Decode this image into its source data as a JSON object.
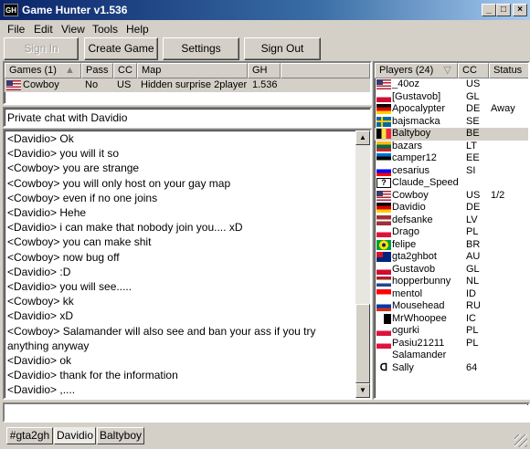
{
  "window": {
    "title": "Game Hunter v1.536",
    "app_icon_text": "GH"
  },
  "menu": [
    "File",
    "Edit",
    "View",
    "Tools",
    "Help"
  ],
  "toolbar": {
    "sign_in": "Sign In",
    "create_game": "Create Game",
    "settings": "Settings",
    "sign_out": "Sign Out"
  },
  "games": {
    "headers": {
      "games": "Games (1)",
      "pass": "Pass",
      "cc": "CC",
      "map": "Map",
      "gh": "GH"
    },
    "rows": [
      {
        "flag": "US",
        "name": "Cowboy",
        "pass": "No",
        "cc": "US",
        "map": "Hidden surprise 2player",
        "gh": "1.536"
      }
    ]
  },
  "chat": {
    "title": "Private chat with Davidio",
    "lines": [
      "<Davidio> Ok",
      "<Davidio> you will it so",
      "<Cowboy> you are strange",
      "<Cowboy> you will only host on your gay map",
      "<Cowboy> even if no one joins",
      "<Davidio> Hehe",
      "<Davidio> i can make that nobody join you.... xD",
      "<Cowboy> you can make shit",
      "<Cowboy> now bug off",
      "<Davidio> :D",
      "<Davidio> you will see.....",
      "<Cowboy> kk",
      "<Davidio> xD",
      "<Cowboy> Salamander will also see and ban your ass if you try anything anyway",
      "<Davidio> ok",
      "<Davidio> thank for the information",
      "<Davidio> ,...."
    ],
    "input_value": ""
  },
  "players": {
    "headers": {
      "players": "Players (24)",
      "cc": "CC",
      "status": "Status"
    },
    "rows": [
      {
        "flag": "US",
        "name": "_40oz",
        "cc": "US",
        "status": ""
      },
      {
        "flag": "GL",
        "name": "[Gustavob]",
        "cc": "GL",
        "status": ""
      },
      {
        "flag": "DE",
        "name": "Apocalypter",
        "cc": "DE",
        "status": "Away"
      },
      {
        "flag": "SE",
        "name": "bajsmacka",
        "cc": "SE",
        "status": ""
      },
      {
        "flag": "BE",
        "name": "Baltyboy",
        "cc": "BE",
        "status": ""
      },
      {
        "flag": "LT",
        "name": "bazars",
        "cc": "LT",
        "status": ""
      },
      {
        "flag": "EE",
        "name": "camper12",
        "cc": "EE",
        "status": ""
      },
      {
        "flag": "SI",
        "name": "cesarius",
        "cc": "SI",
        "status": ""
      },
      {
        "flag": "?",
        "name": "Claude_Speed",
        "cc": "",
        "status": ""
      },
      {
        "flag": "US",
        "name": "Cowboy",
        "cc": "US",
        "status": "1/2"
      },
      {
        "flag": "DE",
        "name": "Davidio",
        "cc": "DE",
        "status": ""
      },
      {
        "flag": "LV",
        "name": "defsanke",
        "cc": "LV",
        "status": ""
      },
      {
        "flag": "PL",
        "name": "Drago",
        "cc": "PL",
        "status": ""
      },
      {
        "flag": "BR",
        "name": "felipe",
        "cc": "BR",
        "status": ""
      },
      {
        "flag": "AU",
        "name": "gta2ghbot",
        "cc": "AU",
        "status": ""
      },
      {
        "flag": "GL",
        "name": "Gustavob",
        "cc": "GL",
        "status": ""
      },
      {
        "flag": "NL",
        "name": "hopperbunny",
        "cc": "NL",
        "status": ""
      },
      {
        "flag": "ID",
        "name": "mentol",
        "cc": "ID",
        "status": ""
      },
      {
        "flag": "RU",
        "name": "Mousehead",
        "cc": "RU",
        "status": ""
      },
      {
        "flag": "IC",
        "name": "MrWhoopee",
        "cc": "IC",
        "status": ""
      },
      {
        "flag": "PL",
        "name": "ogurki",
        "cc": "PL",
        "status": ""
      },
      {
        "flag": "PL",
        "name": "Pasiu21211",
        "cc": "PL",
        "status": ""
      },
      {
        "flag": "",
        "name": "Salamander",
        "cc": "",
        "status": ""
      },
      {
        "flag": "C64",
        "name": "Sally",
        "cc": "64",
        "status": ""
      }
    ]
  },
  "tabs": [
    "#gta2gh",
    "Davidio",
    "Baltyboy"
  ],
  "active_tab": 1
}
